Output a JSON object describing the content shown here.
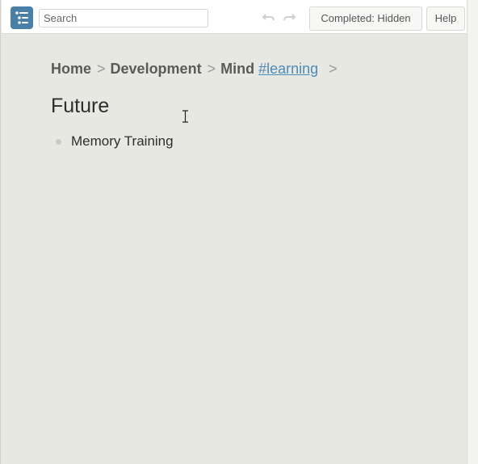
{
  "toolbar": {
    "app_icon": "list-outline-icon",
    "search_placeholder": "Search",
    "undo_icon": "undo-icon",
    "redo_icon": "redo-icon",
    "completed_label": "Completed: Hidden",
    "help_label": "Help"
  },
  "breadcrumb": {
    "items": [
      "Home",
      "Development",
      "Mind"
    ],
    "separator": ">",
    "tag": "#learning"
  },
  "page": {
    "title": "Future",
    "bullets": [
      "Memory Training"
    ]
  },
  "colors": {
    "background": "#e8e8e3",
    "accent": "#4a7fa8",
    "tag_link": "#4d8bb8"
  }
}
